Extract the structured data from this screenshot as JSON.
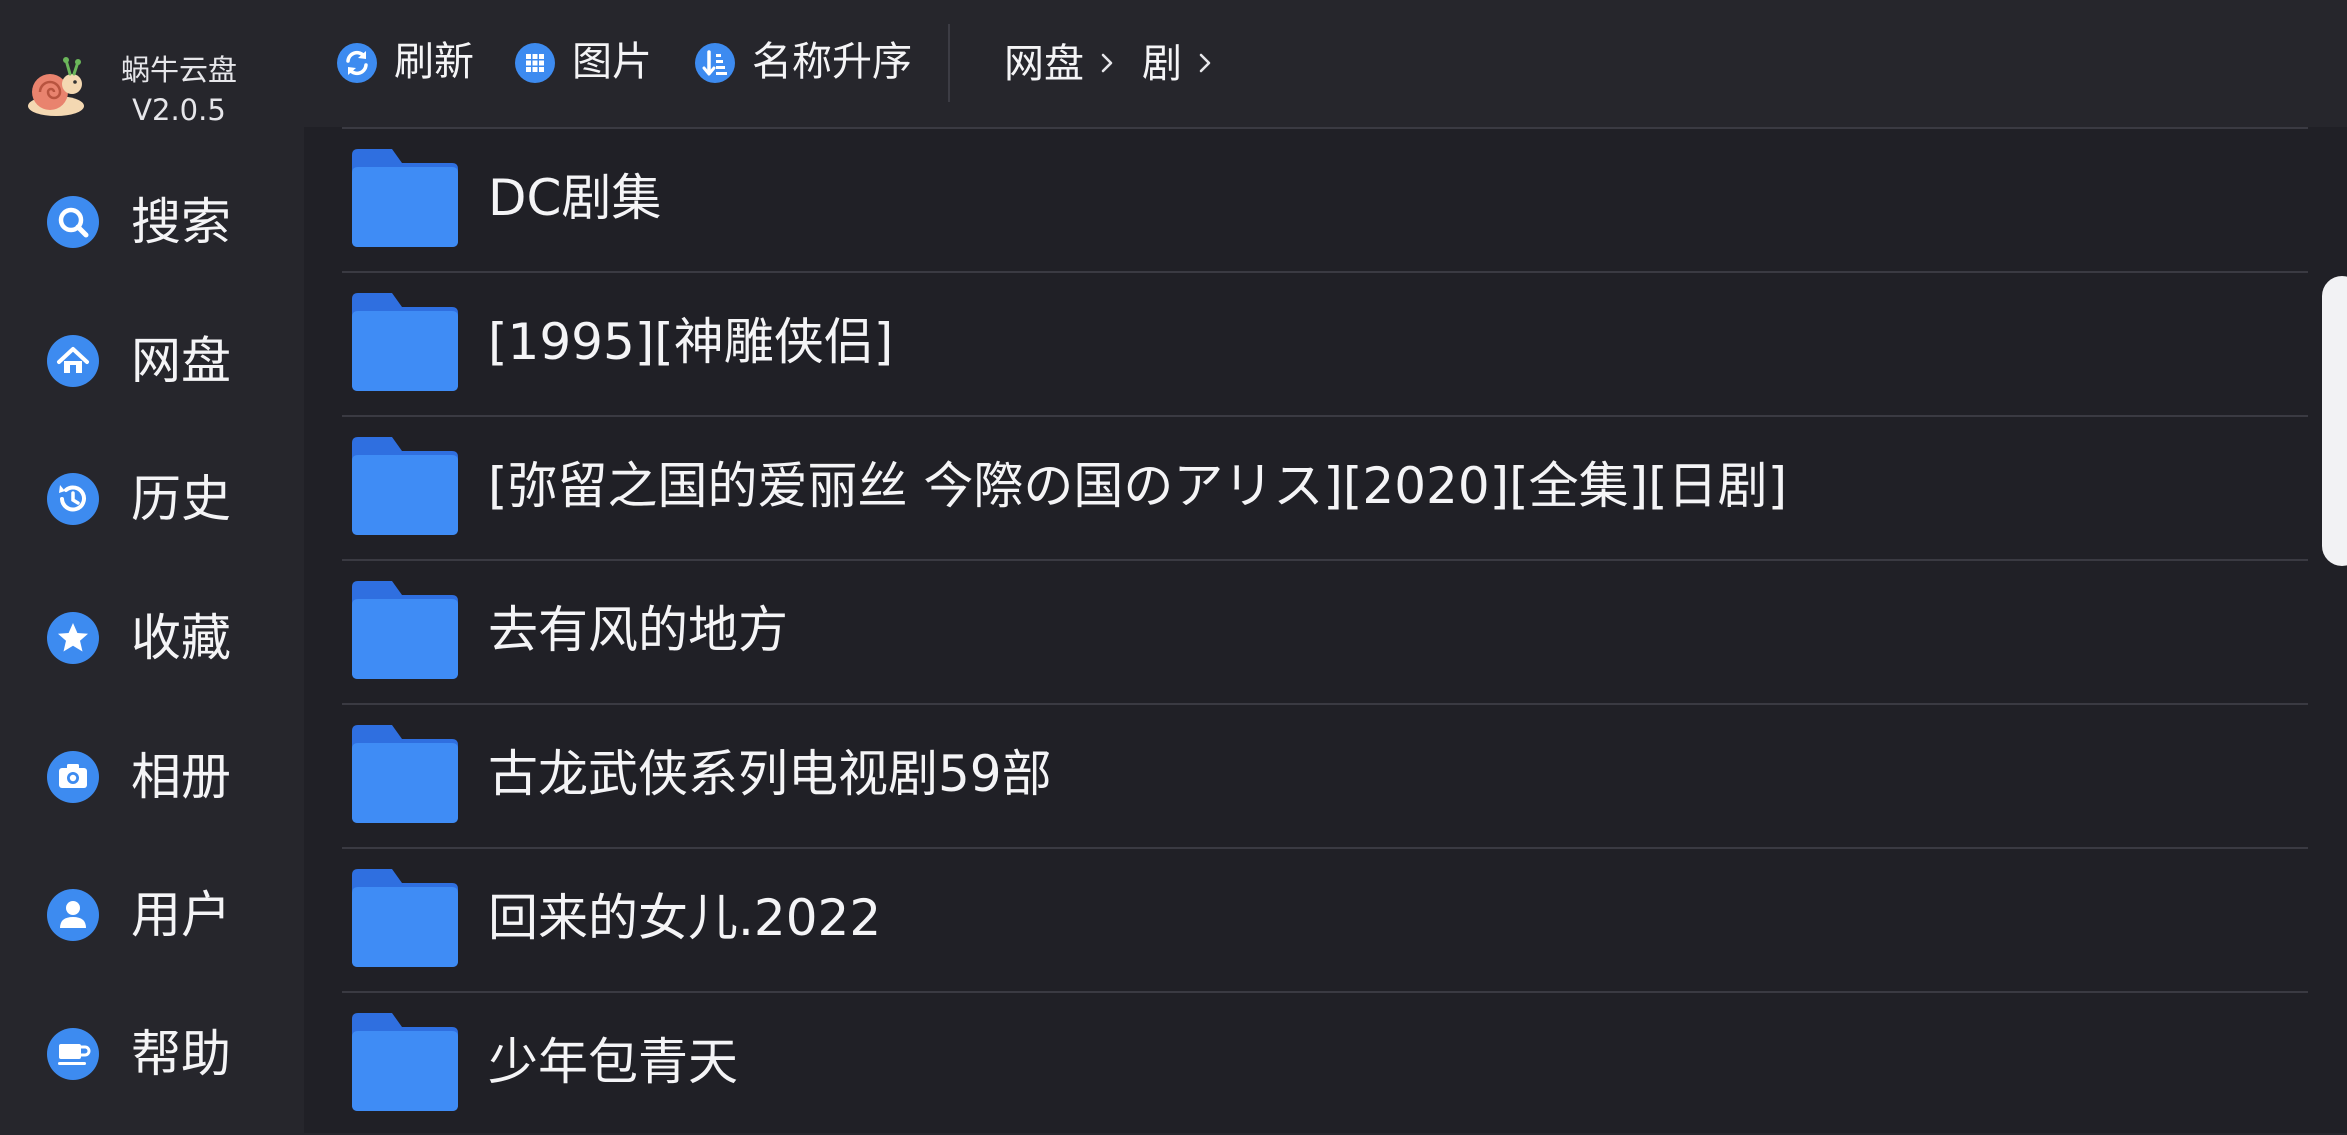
{
  "app": {
    "name": "蜗牛云盘",
    "version": "V2.0.5",
    "accent": "#3d8bf0",
    "folder_color": "#3f8cf5"
  },
  "sidebar": {
    "items": [
      {
        "label": "搜索",
        "icon": "search-icon"
      },
      {
        "label": "网盘",
        "icon": "home-icon"
      },
      {
        "label": "历史",
        "icon": "history-icon"
      },
      {
        "label": "收藏",
        "icon": "star-icon"
      },
      {
        "label": "相册",
        "icon": "camera-icon"
      },
      {
        "label": "用户",
        "icon": "user-icon"
      },
      {
        "label": "帮助",
        "icon": "cup-icon"
      }
    ]
  },
  "toolbar": {
    "refresh_label": "刷新",
    "view_label": "图片",
    "sort_label": "名称升序"
  },
  "breadcrumb": {
    "items": [
      "网盘",
      "剧"
    ]
  },
  "files": [
    {
      "name": "DC剧集"
    },
    {
      "name": "[1995][神雕侠侣]"
    },
    {
      "name": "[弥留之国的爱丽丝 今際の国のアリス][2020][全集][日剧]"
    },
    {
      "name": "去有风的地方"
    },
    {
      "name": "古龙武侠系列电视剧59部"
    },
    {
      "name": "回来的女儿.2022"
    },
    {
      "name": "少年包青天"
    }
  ]
}
